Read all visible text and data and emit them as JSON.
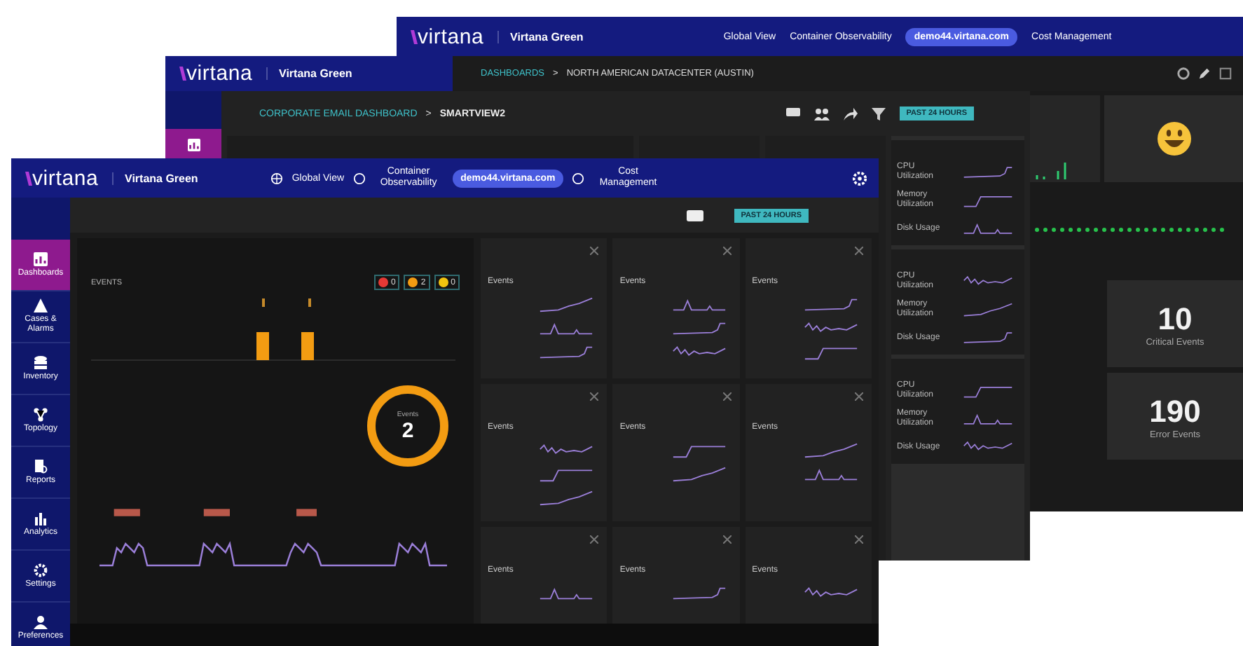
{
  "back_window": {
    "header": {
      "logo": "virtana",
      "tenant": "Virtana Green",
      "nav": [
        "Global View",
        "Container Observability"
      ],
      "host": "demo44.virtana.com",
      "cost": "Cost Management"
    },
    "breadcrumb": {
      "root": "DASHBOARDS",
      "separator": ">",
      "current": "NORTH AMERICAN DATACENTER (AUSTIN)"
    },
    "counters": [
      {
        "value": "10",
        "label": "Critical Events"
      },
      {
        "value": "190",
        "label": "Error Events"
      }
    ]
  },
  "side_window": {
    "header": {
      "logo": "virtana",
      "tenant": "Virtana Green"
    }
  },
  "dashboard_window": {
    "title": "CORPORATE EMAIL DASHBOARD",
    "separator": ">",
    "subtitle": "SMARTVIEW2",
    "time_button": "PAST 24 HOURS",
    "cards": [
      {
        "rows": [
          "CPU Utilization",
          "Memory Utilization",
          "Disk Usage"
        ]
      },
      {
        "rows": [
          "CPU Utilization",
          "Memory Utilization",
          "Disk Usage"
        ]
      },
      {
        "rows": [
          "CPU Utilization",
          "Memory Utilization",
          "Disk Usage"
        ]
      }
    ]
  },
  "front_window": {
    "header": {
      "logo": "virtana",
      "tenant": "Virtana Green",
      "nav": [
        "Global View",
        "Container Observability"
      ],
      "host": "demo44.virtana.com",
      "cost": "Cost Management"
    },
    "sidebar": [
      {
        "label": "Dashboards",
        "selected": true
      },
      {
        "label": "Cases & Alarms",
        "selected": false
      },
      {
        "label": "Inventory",
        "selected": false
      },
      {
        "label": "Topology",
        "selected": false
      },
      {
        "label": "Reports",
        "selected": false
      },
      {
        "label": "Analytics",
        "selected": false
      },
      {
        "label": "Settings",
        "selected": false
      },
      {
        "label": "Preferences",
        "selected": false
      }
    ],
    "time_button": "PAST 24 HOURS",
    "events_panel": {
      "title": "EVENTS",
      "badges": [
        {
          "count": "0",
          "color": "#e53935"
        },
        {
          "count": "2",
          "color": "#f39c12"
        },
        {
          "count": "0",
          "color": "#f1c40f"
        }
      ],
      "donut": {
        "label": "Events",
        "value": "2"
      }
    },
    "cards": [
      {
        "rows": [
          {
            "kind": "events",
            "label": "Events"
          },
          {
            "kind": "spark"
          },
          {
            "kind": "spark"
          },
          {
            "kind": "spark"
          }
        ]
      },
      {
        "rows": [
          {
            "kind": "events",
            "label": "Events"
          },
          {
            "kind": "spark"
          },
          {
            "kind": "spark"
          },
          {
            "kind": "spark"
          }
        ]
      },
      {
        "rows": [
          {
            "kind": "events",
            "label": "Events"
          },
          {
            "kind": "spark"
          },
          {
            "kind": "spark"
          },
          {
            "kind": "spark"
          }
        ]
      },
      {
        "rows": [
          {
            "kind": "events",
            "label": "Events"
          },
          {
            "kind": "spark"
          },
          {
            "kind": "spark"
          },
          {
            "kind": "spark"
          }
        ]
      },
      {
        "rows": [
          {
            "kind": "events",
            "label": "Events"
          },
          {
            "kind": "spark"
          },
          {
            "kind": "spark"
          }
        ]
      },
      {
        "rows": [
          {
            "kind": "events",
            "label": "Events"
          },
          {
            "kind": "spark"
          },
          {
            "kind": "spark"
          }
        ]
      },
      {
        "rows": [
          {
            "kind": "events",
            "label": "Events"
          },
          {
            "kind": "spark"
          }
        ]
      },
      {
        "rows": [
          {
            "kind": "events",
            "label": "Events"
          },
          {
            "kind": "spark"
          }
        ]
      },
      {
        "rows": [
          {
            "kind": "events",
            "label": "Events"
          },
          {
            "kind": "spark"
          }
        ]
      }
    ]
  }
}
